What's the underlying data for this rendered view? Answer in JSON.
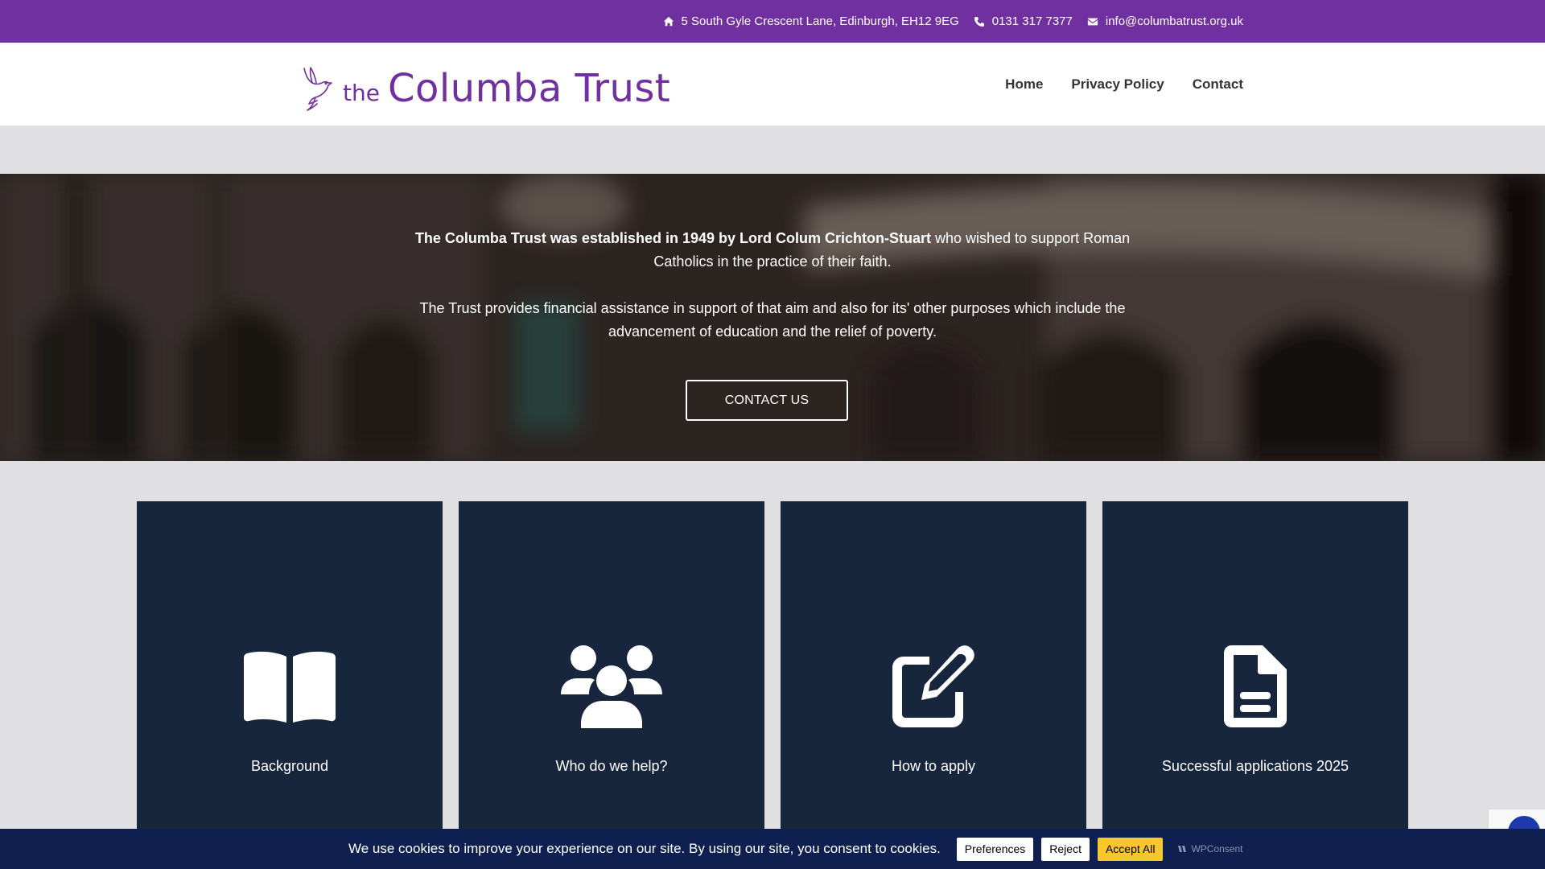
{
  "topbar": {
    "address": "5 South Gyle Crescent Lane, Edinburgh, EH12 9EG",
    "phone": "0131 317 7377",
    "email": "info@columbatrust.org.uk"
  },
  "logo": {
    "the": "the",
    "name": "Columba Trust"
  },
  "nav": {
    "items": [
      "Home",
      "Privacy Policy",
      "Contact"
    ]
  },
  "hero": {
    "intro_bold": "The Columba Trust was established in 1949 by Lord Colum Crichton-Stuart",
    "intro_rest": " who wished to support Roman Catholics in the practice of their faith.",
    "paragraph2": "The Trust provides financial assistance in support of that aim and also for its' other purposes which include the advancement of education and the relief of poverty.",
    "button": "CONTACT US"
  },
  "cards": [
    {
      "label": "Background",
      "icon": "book-open-icon"
    },
    {
      "label": "Who do we help?",
      "icon": "users-icon"
    },
    {
      "label": "How to apply",
      "icon": "edit-icon"
    },
    {
      "label": "Successful applications 2025",
      "icon": "file-text-icon"
    }
  ],
  "cookie": {
    "message": "We use cookies to improve your experience on our site. By using our site, you consent to cookies.",
    "preferences": "Preferences",
    "reject": "Reject",
    "accept": "Accept All",
    "brand": "WPConsent"
  },
  "colors": {
    "brand_purple": "#7030a0",
    "card_navy": "#17263d",
    "cookie_navy": "#0f2050",
    "accept_yellow": "#f8c72b"
  }
}
